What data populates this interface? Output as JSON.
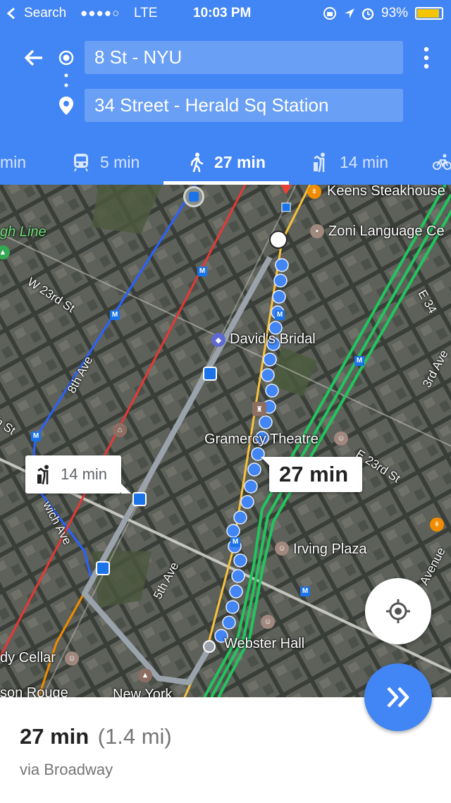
{
  "status_bar": {
    "back_app": "Search",
    "signal": "●●●●○",
    "network": "LTE",
    "time": "10:03 PM",
    "battery": "93%"
  },
  "route": {
    "origin": "8 St - NYU",
    "destination": "34 Street - Herald Sq Station"
  },
  "tabs": [
    {
      "label": "min",
      "icon": "car-icon"
    },
    {
      "label": "5 min",
      "icon": "transit-icon"
    },
    {
      "label": "27 min",
      "icon": "walk-icon",
      "active": true
    },
    {
      "label": "14 min",
      "icon": "ride-share-icon"
    },
    {
      "label": "",
      "icon": "bike-icon"
    }
  ],
  "map": {
    "labels": {
      "keens": "Keens Steakhouse",
      "high_line": "gh Line",
      "zoni": "Zoni Language Ce",
      "w23": "W 23rd St",
      "e34": "E 34",
      "davids": "David's Bridal",
      "ave8": "8th Ave",
      "ave3": "3rd Ave",
      "gramercy": "Gramercy Theatre",
      "e23": "E 23rd St",
      "west14": "h St",
      "greenwich": "wich Ave",
      "irving": "Irving Plaza",
      "ave5": "5th Ave",
      "avenue": "Avenue",
      "webster": "Webster Hall",
      "cellar": "dy Cellar",
      "rouge": "son Rouge",
      "newyork": "New York"
    },
    "callout_walk": "27 min",
    "callout_rideshare": "14 min",
    "colors": {
      "walk_route": "#4285f4",
      "alt_route": "#9aa3ab",
      "blue_line": "#2962ff",
      "red_line": "#e53935",
      "green_line": "#22c55e",
      "yellow_line": "#f9c23c"
    }
  },
  "summary": {
    "duration": "27 min",
    "distance": "(1.4 mi)",
    "via": "via Broadway"
  }
}
